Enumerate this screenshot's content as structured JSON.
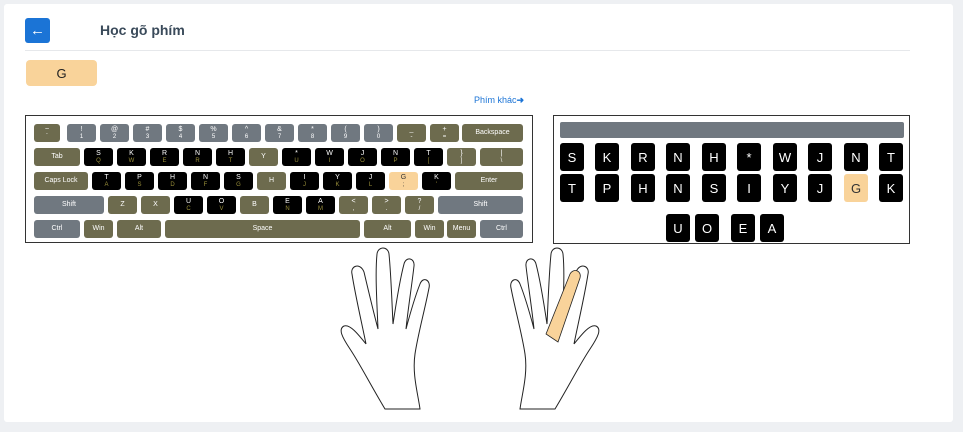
{
  "header": {
    "back_icon": "arrow-left-icon",
    "title": "Học gõ phím"
  },
  "target_key": "G",
  "other_link": "Phím khác",
  "colors": {
    "accent": "#1b74d6",
    "highlight": "#f9d39a",
    "olive": "#6d6b4e",
    "gray": "#707880"
  },
  "keyboard": {
    "rows": [
      [
        {
          "t": "~",
          "b": "`"
        },
        {
          "t": "!",
          "b": "1"
        },
        {
          "t": "@",
          "b": "2"
        },
        {
          "t": "#",
          "b": "3"
        },
        {
          "t": "$",
          "b": "4"
        },
        {
          "t": "%",
          "b": "5"
        },
        {
          "t": "^",
          "b": "6"
        },
        {
          "t": "&",
          "b": "7"
        },
        {
          "t": "*",
          "b": "8"
        },
        {
          "t": "(",
          "b": "9"
        },
        {
          "t": ")",
          "b": "0"
        },
        {
          "t": "_",
          "b": "-"
        },
        {
          "t": "+",
          "b": "="
        },
        {
          "t": "Backspace",
          "b": ""
        }
      ],
      [
        {
          "t": "Tab",
          "b": ""
        },
        {
          "t": "S",
          "b": "Q"
        },
        {
          "t": "K",
          "b": "W"
        },
        {
          "t": "R",
          "b": "E"
        },
        {
          "t": "N",
          "b": "R"
        },
        {
          "t": "H",
          "b": "T"
        },
        {
          "t": "Y",
          "b": ""
        },
        {
          "t": "*",
          "b": "U"
        },
        {
          "t": "W",
          "b": "I"
        },
        {
          "t": "J",
          "b": "O"
        },
        {
          "t": "N",
          "b": "P"
        },
        {
          "t": "T",
          "b": "["
        },
        {
          "t": "}",
          "b": "]"
        },
        {
          "t": "|",
          "b": "\\"
        }
      ],
      [
        {
          "t": "Caps Lock",
          "b": ""
        },
        {
          "t": "T",
          "b": "A"
        },
        {
          "t": "P",
          "b": "S"
        },
        {
          "t": "H",
          "b": "D"
        },
        {
          "t": "N",
          "b": "F"
        },
        {
          "t": "S",
          "b": "G"
        },
        {
          "t": "H",
          "b": ""
        },
        {
          "t": "I",
          "b": "J"
        },
        {
          "t": "Y",
          "b": "K"
        },
        {
          "t": "J",
          "b": "L"
        },
        {
          "t": "G",
          "b": ";"
        },
        {
          "t": "K",
          "b": "'"
        },
        {
          "t": "Enter",
          "b": ""
        }
      ],
      [
        {
          "t": "Shift",
          "b": ""
        },
        {
          "t": "Z",
          "b": ""
        },
        {
          "t": "X",
          "b": ""
        },
        {
          "t": "U",
          "b": "C"
        },
        {
          "t": "O",
          "b": "V"
        },
        {
          "t": "B",
          "b": ""
        },
        {
          "t": "E",
          "b": "N"
        },
        {
          "t": "A",
          "b": "M"
        },
        {
          "t": "<",
          "b": ","
        },
        {
          "t": ">",
          "b": "."
        },
        {
          "t": "?",
          "b": "/"
        },
        {
          "t": "Shift",
          "b": ""
        }
      ],
      [
        {
          "t": "Ctrl",
          "b": ""
        },
        {
          "t": "Win",
          "b": ""
        },
        {
          "t": "Alt",
          "b": ""
        },
        {
          "t": "Space",
          "b": ""
        },
        {
          "t": "Alt",
          "b": ""
        },
        {
          "t": "Win",
          "b": ""
        },
        {
          "t": "Menu",
          "b": ""
        },
        {
          "t": "Ctrl",
          "b": ""
        }
      ]
    ]
  },
  "steno": {
    "row1": [
      "S",
      "K",
      "R",
      "N",
      "H",
      "*",
      "W",
      "J",
      "N",
      "T"
    ],
    "row2": [
      "T",
      "P",
      "H",
      "N",
      "S",
      "I",
      "Y",
      "J",
      "G",
      "K"
    ],
    "vowels": [
      "U",
      "O",
      "E",
      "A"
    ]
  }
}
